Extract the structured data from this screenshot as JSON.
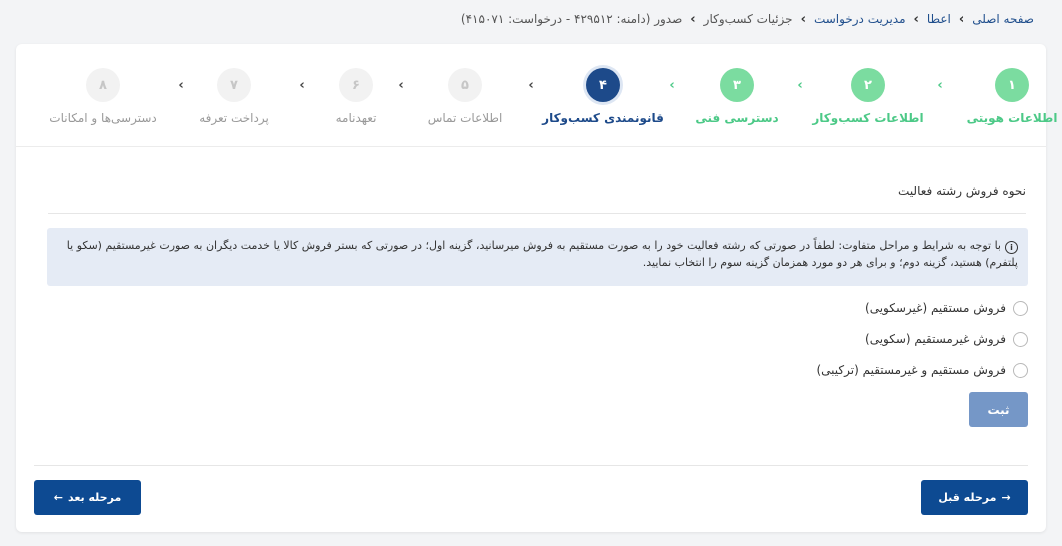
{
  "breadcrumb": {
    "items": [
      {
        "label": "صفحه اصلی"
      },
      {
        "label": "اعطا"
      },
      {
        "label": "مدیریت درخواست"
      },
      {
        "label": "جزئیات کسب‌وکار"
      },
      {
        "label": "صدور (دامنه: ۴۲۹۵۱۲ - درخواست: ۴۱۵۰۷۱)"
      }
    ]
  },
  "stepper": {
    "steps": [
      {
        "number": "۱",
        "label": "اطلاعات هویتی",
        "status": "done"
      },
      {
        "number": "۲",
        "label": "اطلاعات کسب‌وکار",
        "status": "done"
      },
      {
        "number": "۳",
        "label": "دسترسی فنی",
        "status": "done"
      },
      {
        "number": "۴",
        "label": "قانونمندی کسب‌وکار",
        "status": "active"
      },
      {
        "number": "۵",
        "label": "اطلاعات تماس",
        "status": "todo"
      },
      {
        "number": "۶",
        "label": "تعهدنامه",
        "status": "todo"
      },
      {
        "number": "۷",
        "label": "پرداخت تعرفه",
        "status": "todo"
      },
      {
        "number": "۸",
        "label": "دسترسی‌ها و امکانات",
        "status": "todo"
      }
    ],
    "chevron": "›"
  },
  "section": {
    "title": "نحوه فروش رشته فعالیت"
  },
  "info": {
    "icon": "info-circle-icon",
    "icon_glyph": "i",
    "text": "با توجه به شرایط و مراحل متفاوت: لطفاً در صورتی که رشته فعالیت خود را به صورت مستقیم به فروش میرسانید، گزینه اول؛ در صورتی که بستر فروش کالا یا خدمت دیگران به صورت غیرمستقیم (سکو یا پلتفرم) هستید، گزینه دوم؛ و برای هر دو مورد همزمان گزینه سوم را انتخاب نمایید."
  },
  "options": [
    {
      "label": "فروش مستقیم (غیرسکویی)"
    },
    {
      "label": "فروش غیرمستقیم (سکویی)"
    },
    {
      "label": "فروش مستقیم و غیرمستقیم (ترکیبی)"
    }
  ],
  "buttons": {
    "submit": "ثبت",
    "previous": "مرحله قبل",
    "next": "مرحله بعد"
  },
  "colors": {
    "primary": "#0d4a92",
    "success": "#4cc987",
    "submit_disabled": "#7597c7",
    "info_bg": "#e5ebf5"
  }
}
